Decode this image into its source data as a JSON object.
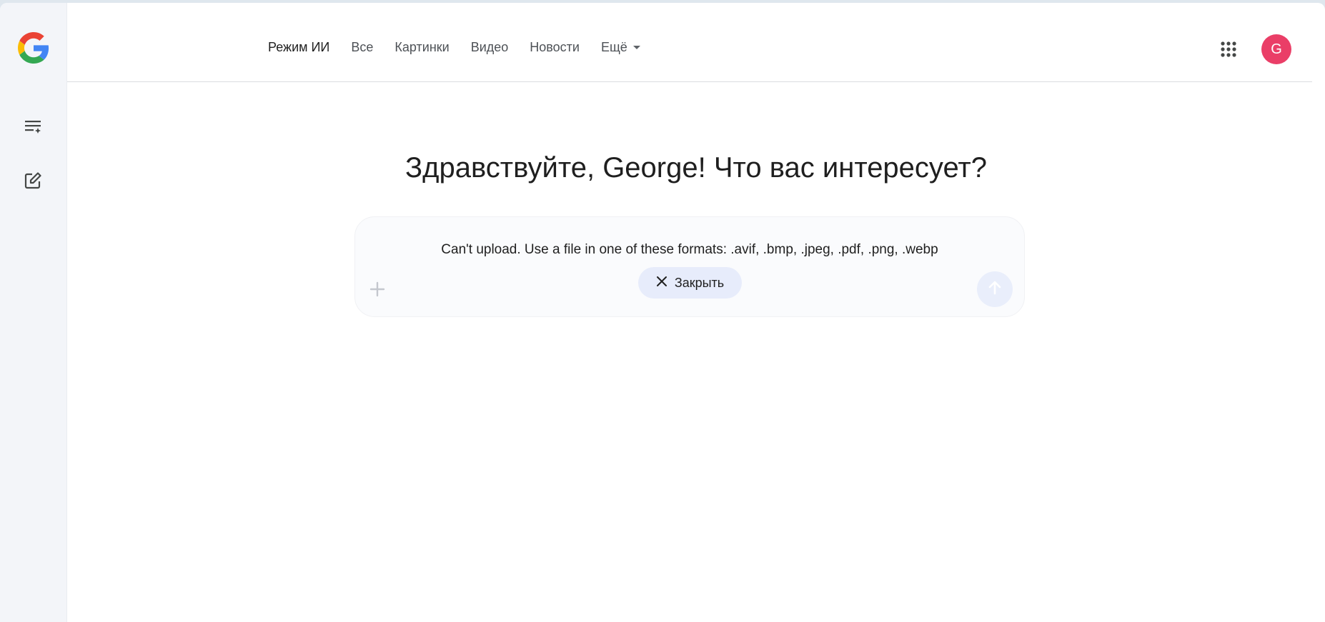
{
  "nav": {
    "items": [
      {
        "label": "Режим ИИ",
        "active": true
      },
      {
        "label": "Все"
      },
      {
        "label": "Картинки"
      },
      {
        "label": "Видео"
      },
      {
        "label": "Новости"
      }
    ],
    "more_label": "Ещё"
  },
  "user": {
    "avatar_letter": "G",
    "avatar_color": "#ea3e67"
  },
  "main": {
    "greeting": "Здравствуйте, George! Что вас интересует?",
    "error_message": "Can't upload. Use a file in one of these formats: .avif, .bmp, .jpeg, .pdf, .png, .webp",
    "close_label": "Закрыть"
  },
  "icons": {
    "logo": "google-g-logo",
    "history": "history-list-icon",
    "new_chat": "edit-icon",
    "apps": "apps-grid-icon",
    "plus": "plus-icon",
    "send": "arrow-up-icon",
    "close": "close-icon"
  }
}
